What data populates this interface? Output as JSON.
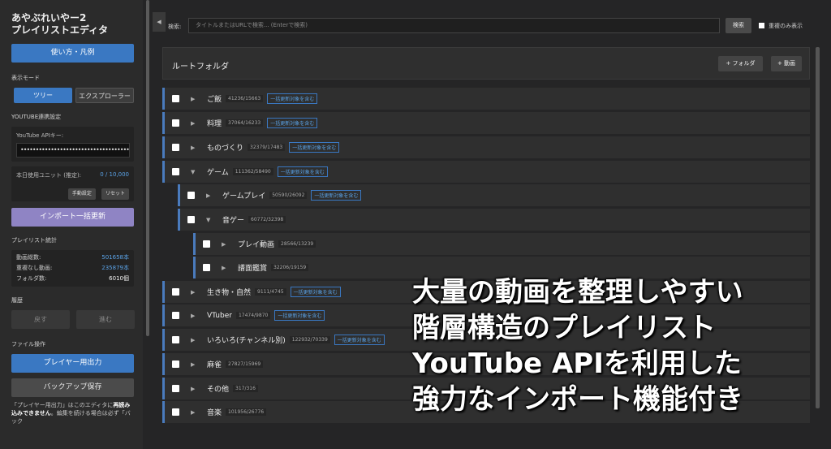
{
  "sidebar": {
    "title_line1": "あやぶれいやー2",
    "title_line2": "プレイリストエディタ",
    "help_button": "使い方・凡例",
    "display_mode_label": "表示モード",
    "mode_tree": "ツリー",
    "mode_explorer": "エクスプローラー",
    "youtube_section_label": "YOUTUBE連携設定",
    "api_key_label": "YouTube APIキー:",
    "api_key_value": "••••••••••••••••••••••••••••••••••••••",
    "units_label": "本日使用ユニット (推定):",
    "units_value": "0 / 10,000",
    "manual_button": "手動設定",
    "reset_button": "リセット",
    "import_button": "インポート一括更新",
    "stats_label": "プレイリスト統計",
    "stats": [
      {
        "label": "動画総数:",
        "value": "501658本"
      },
      {
        "label": "重複なし動画:",
        "value": "235879本"
      },
      {
        "label": "フォルダ数:",
        "value": "6010個"
      }
    ],
    "history_label": "履歴",
    "undo_button": "戻す",
    "redo_button": "進む",
    "file_ops_label": "ファイル操作",
    "player_output_button": "プレイヤー用出力",
    "backup_button": "バックアップ保存",
    "note_prefix": "「プレイヤー用出力」はこのエディタに",
    "note_bold": "再読み込みできません",
    "note_suffix": "。編集を続ける場合は必ず「バック"
  },
  "collapse_icon": "◀",
  "search": {
    "label": "検索:",
    "placeholder": "タイトルまたはURLで検索... (Enterで検索)",
    "button": "検索",
    "dup_only_label": "重複のみ表示"
  },
  "root": {
    "title": "ルートフォルダ",
    "add_folder": "+ フォルダ",
    "add_video": "+ 動画"
  },
  "tree": [
    {
      "name": "ご飯",
      "count": "41236/15663",
      "badge": "一括更新対象を含む",
      "caret": "▶"
    },
    {
      "name": "料理",
      "count": "37064/16233",
      "badge": "一括更新対象を含む",
      "caret": "▶"
    },
    {
      "name": "ものづくり",
      "count": "32379/17483",
      "badge": "一括更新対象を含む",
      "caret": "▶"
    },
    {
      "name": "ゲーム",
      "count": "111362/58490",
      "badge": "一括更新対象を含む",
      "caret": "▼"
    },
    {
      "name": "ゲームプレイ",
      "count": "50590/26092",
      "badge": "一括更新対象を含む",
      "caret": "▶"
    },
    {
      "name": "音ゲー",
      "count": "60772/32398",
      "caret": "▼"
    },
    {
      "name": "プレイ動画",
      "count": "28566/13239",
      "caret": "▶"
    },
    {
      "name": "譜面鑑賞",
      "count": "32206/19159",
      "caret": "▶"
    },
    {
      "name": "生き物・自然",
      "count": "9111/4745",
      "badge": "一括更新対象を含む",
      "caret": "▶"
    },
    {
      "name": "VTuber",
      "count": "17474/9870",
      "badge": "一括更新対象を含む",
      "caret": "▶"
    },
    {
      "name": "いろいろ(チャンネル別)",
      "count": "122932/70339",
      "badge": "一括更新対象を含む",
      "caret": "▶"
    },
    {
      "name": "麻雀",
      "count": "27827/15969",
      "caret": "▶"
    },
    {
      "name": "その他",
      "count": "317/316",
      "caret": "▶"
    },
    {
      "name": "音楽",
      "count": "101956/26776",
      "caret": "▶"
    }
  ],
  "overlay": {
    "line1": "大量の動画を整理しやすい",
    "line2": "階層構造のプレイリスト",
    "line3": "YouTube APIを利用した",
    "line4": "強力なインポート機能付き"
  },
  "colors": {
    "accent_blue": "#3a78c2",
    "import_purple": "#8f84c4",
    "stat_blue": "#5aa2e6"
  }
}
